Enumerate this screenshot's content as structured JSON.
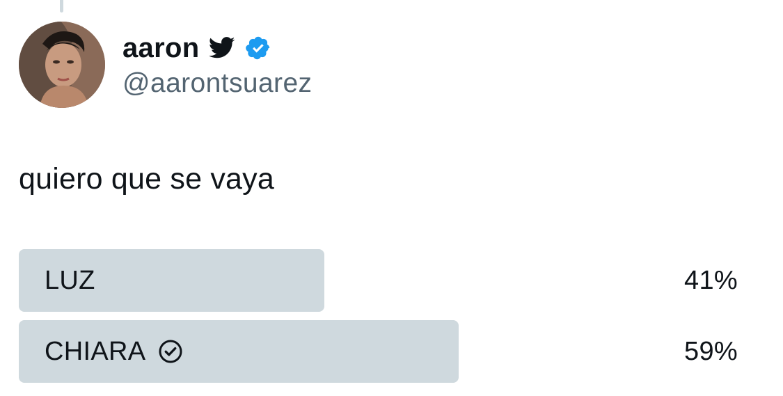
{
  "tweet": {
    "display_name": "aaron",
    "handle": "@aarontsuarez",
    "text": "quiero que se vaya",
    "icons": [
      "twitter-bird-icon",
      "verified-badge-icon"
    ]
  },
  "poll": {
    "options": [
      {
        "label": "LUZ",
        "percent_text": "41%",
        "percent": 41,
        "selected": false
      },
      {
        "label": "CHIARA",
        "percent_text": "59%",
        "percent": 59,
        "selected": true,
        "icon": "check-circle-icon"
      }
    ]
  },
  "colors": {
    "bar": "#cfd9de",
    "verified": "#1d9bf0",
    "text": "#0f1419",
    "secondary_text": "#536471"
  }
}
